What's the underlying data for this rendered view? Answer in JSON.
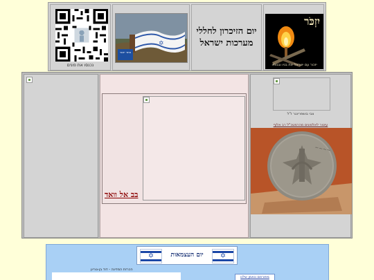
{
  "header": {
    "qr_caption": "נכנסו את פונים",
    "flag_badge": "אתר\nיזכור",
    "title_line1": "יום הזיכרון לחללי",
    "title_line2": "מערכות ישראל",
    "yizkor_word": "יִזְכֹּר",
    "yizkor_caption": "יזכור עם ישראל את בניו ובנותיו"
  },
  "main": {
    "inner_title": "בב אל וואד",
    "right_caption1": "צבי בושפרינגר ז\"ל",
    "right_caption2": "עיטור לאלמונים מהרמטכ\"ל רב אלוף"
  },
  "bottom": {
    "banner_title": "יום העצמאות",
    "caption": "הכרזת המדינה - דוד בן-גוריון",
    "link_text": "מפורסם ונאמן שלנו"
  },
  "colors": {
    "page_bg": "#ffffd9",
    "panel_gray": "#d4d4d4",
    "panel_pink": "#f3e4e4",
    "bottom_blue": "#a9d0f5",
    "title_red": "#8a0000"
  },
  "icons": [
    "qr-code-icon",
    "flag-photo",
    "torch-icon",
    "broken-image-icon",
    "medal-photo",
    "israel-flag-icon"
  ]
}
